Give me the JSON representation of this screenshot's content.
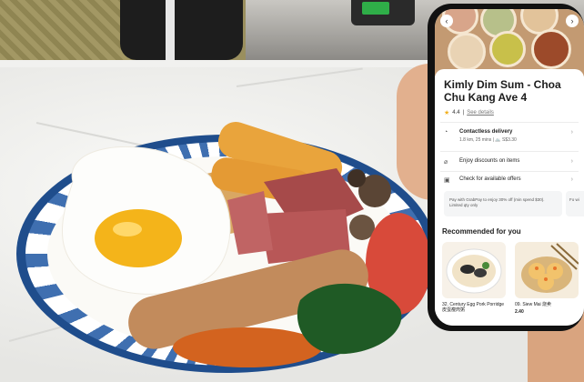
{
  "store": {
    "name": "Kimly Dim Sum - Choa Chu Kang Ave 4",
    "rating": "4.4",
    "see_details": "See details"
  },
  "delivery": {
    "label": "Contactless delivery",
    "sub": "1.8 km, 25 mins | 🚲 S$3.30"
  },
  "options": [
    {
      "label": "Enjoy discounts on items"
    },
    {
      "label": "Check for available offers"
    }
  ],
  "promos": [
    {
      "text": "Pay with GrabPay to enjoy 30% off (min spend $30). Limited qty only"
    },
    {
      "text": "Fo wi"
    }
  ],
  "recommended": {
    "title": "Recommended for you",
    "items": [
      {
        "name": "32. Century Egg Pork Porridge 皮蛋瘦肉粥",
        "price": ""
      },
      {
        "name": "09. Siew Mai 烧卖",
        "price": "2.40"
      }
    ]
  },
  "colors": {
    "plate_blue": "#1f4d8c",
    "accent_star": "#f2b01e"
  }
}
